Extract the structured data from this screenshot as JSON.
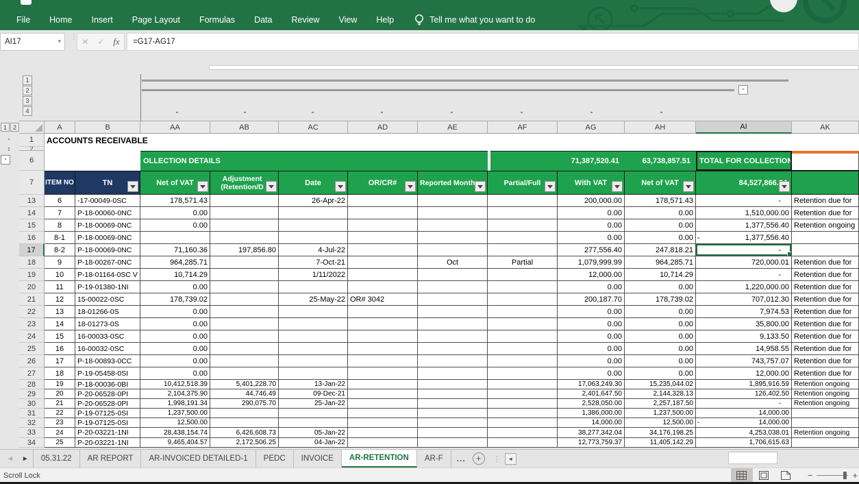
{
  "colors": {
    "ribbon_green": "#217346",
    "header_green": "#1FA24D",
    "header_navy": "#1F3864",
    "selection_green": "#1E7145",
    "orange_accent": "#E8752B"
  },
  "icons": {
    "lightbulb": "bulb",
    "namebox_caret": "▾",
    "cancel": "✕",
    "confirm": "✓",
    "fx": "fx",
    "nav_left": "◄",
    "nav_right": "►",
    "scroll_left": "◄",
    "add_sheet": "+",
    "overflow_dots": "...",
    "zoom_minus": "−",
    "zoom_plus": "+",
    "outline_collapse": "-"
  },
  "ribbon": {
    "tabs": [
      "File",
      "Home",
      "Insert",
      "Page Layout",
      "Formulas",
      "Data",
      "Review",
      "View",
      "Help"
    ],
    "tell_me": "Tell me what you want to do"
  },
  "formula_bar": {
    "name_box": "AI17",
    "formula": "=G17-AG17"
  },
  "outline": {
    "col_levels": [
      "1",
      "2",
      "3",
      "4"
    ],
    "row_levels": [
      "1",
      "2"
    ]
  },
  "sheet": {
    "columns": [
      "A",
      "B",
      "AA",
      "AB",
      "AC",
      "AD",
      "AE",
      "AF",
      "AG",
      "AH",
      "AI",
      "AK"
    ],
    "selected_column": "AI",
    "active_row": 17,
    "row1_title": "ACCOUNTS RECEIVABLE",
    "row1_num": "1",
    "row2_num": "2",
    "row6_num": "6",
    "row7_num": "7",
    "row6": {
      "collection_details": "OLLECTION DETAILS",
      "ag_total": "71,387,520.41",
      "ah_total": "63,738,857.51",
      "ai_label": "TOTAL FOR COLLECTION"
    },
    "row7": {
      "a": "ITEM NO",
      "b": "TN",
      "aa": "Net of VAT",
      "ab_line1": "Adjustment",
      "ab_line2": "(Retention/D",
      "ac": "Date",
      "ad": "OR/CR#",
      "ae": "Reported Month",
      "af": "Partial/Full",
      "ag": "With VAT",
      "ah": "Net of VAT",
      "ai_total": "84,527,866.84"
    },
    "rows": [
      {
        "r": "13",
        "item": "6",
        "tn": "-17-00049-0SC",
        "aa": "178,571.43",
        "ab": "",
        "ac": "26-Apr-22",
        "ad": "",
        "ae": "",
        "af": "",
        "ag": "200,000.00",
        "ah": "178,571.43",
        "ai": "-",
        "ak": "Retention due for"
      },
      {
        "r": "14",
        "item": "7",
        "tn": "P-18-00060-0NC",
        "aa": "0.00",
        "ab": "",
        "ac": "",
        "ad": "",
        "ae": "",
        "af": "",
        "ag": "0.00",
        "ah": "0.00",
        "ai": "1,510,000.00",
        "ak": "Retention due for"
      },
      {
        "r": "15",
        "item": "8",
        "tn": "P-18-00069-0NC",
        "aa": "0.00",
        "ab": "",
        "ac": "",
        "ad": "",
        "ae": "",
        "af": "",
        "ag": "0.00",
        "ah": "0.00",
        "ai": "1,377,556.40",
        "ak": "Retention ongoing"
      },
      {
        "r": "16",
        "item": "8-1",
        "tn": "P-18-00069-0NC",
        "aa": "",
        "ab": "",
        "ac": "",
        "ad": "",
        "ae": "",
        "af": "",
        "ag": "0.00",
        "ah": "0.00",
        "ai": "-1,377,556.40",
        "ak": ""
      },
      {
        "r": "17",
        "item": "8-2",
        "tn": "P-18-00069-0NC",
        "aa": "71,160.36",
        "ab": "197,856.80",
        "ac": "4-Jul-22",
        "ad": "",
        "ae": "",
        "af": "",
        "ag": "277,556.40",
        "ah": "247,818.21",
        "ai": "-",
        "ak": ""
      },
      {
        "r": "18",
        "item": "9",
        "tn": "P-18-00267-0NC",
        "aa": "964,285.71",
        "ab": "",
        "ac": "7-Oct-21",
        "ad": "",
        "ae": "Oct",
        "af": "Partial",
        "ag": "1,079,999.99",
        "ah": "964,285.71",
        "ai": "720,000.01",
        "ak": "Retention due for"
      },
      {
        "r": "19",
        "item": "10",
        "tn": "P-18-01164-0SC V",
        "aa": "10,714.29",
        "ab": "",
        "ac": "1/11/2022",
        "ad": "",
        "ae": "",
        "af": "",
        "ag": "12,000.00",
        "ah": "10,714.29",
        "ai": "-",
        "ak": "Retention due for"
      },
      {
        "r": "20",
        "item": "11",
        "tn": "P-19-01380-1NI",
        "aa": "0.00",
        "ab": "",
        "ac": "",
        "ad": "",
        "ae": "",
        "af": "",
        "ag": "0.00",
        "ah": "0.00",
        "ai": "1,220,000.00",
        "ak": "Retention due for"
      },
      {
        "r": "21",
        "item": "12",
        "tn": "15-00022-0SC",
        "aa": "178,739.02",
        "ab": "",
        "ac": "25-May-22",
        "ad": "OR# 3042",
        "ae": "",
        "af": "",
        "ag": "200,187.70",
        "ah": "178,739.02",
        "ai": "707,012.30",
        "ak": "Retention due for"
      },
      {
        "r": "22",
        "item": "13",
        "tn": "18-01266-0S",
        "aa": "0.00",
        "ab": "",
        "ac": "",
        "ad": "",
        "ae": "",
        "af": "",
        "ag": "0.00",
        "ah": "0.00",
        "ai": "7,974.53",
        "ak": "Retention due for"
      },
      {
        "r": "23",
        "item": "14",
        "tn": "18-01273-0S",
        "aa": "0.00",
        "ab": "",
        "ac": "",
        "ad": "",
        "ae": "",
        "af": "",
        "ag": "0.00",
        "ah": "0.00",
        "ai": "35,800.00",
        "ak": "Retention due for"
      },
      {
        "r": "24",
        "item": "15",
        "tn": "16-00033-0SC",
        "aa": "0.00",
        "ab": "",
        "ac": "",
        "ad": "",
        "ae": "",
        "af": "",
        "ag": "0.00",
        "ah": "0.00",
        "ai": "9,133.50",
        "ak": "Retention due for"
      },
      {
        "r": "25",
        "item": "16",
        "tn": "16-00032-0SC",
        "aa": "0.00",
        "ab": "",
        "ac": "",
        "ad": "",
        "ae": "",
        "af": "",
        "ag": "0.00",
        "ah": "0.00",
        "ai": "14,958.55",
        "ak": "Retention due for"
      },
      {
        "r": "26",
        "item": "17",
        "tn": "P-18-00893-0CC",
        "aa": "0.00",
        "ab": "",
        "ac": "",
        "ad": "",
        "ae": "",
        "af": "",
        "ag": "0.00",
        "ah": "0.00",
        "ai": "743,757.07",
        "ak": "Retention due for"
      },
      {
        "r": "27",
        "item": "18",
        "tn": "P-19-05458-0SI",
        "aa": "0.00",
        "ab": "",
        "ac": "",
        "ad": "",
        "ae": "",
        "af": "",
        "ag": "0.00",
        "ah": "0.00",
        "ai": "12,000.00",
        "ak": "Retention due for"
      },
      {
        "r": "28",
        "item": "19",
        "tn": "P-18-00036-0BI",
        "aa": "10,412,518.39",
        "ab": "5,401,228.70",
        "ac": "13-Jan-22",
        "ad": "",
        "ae": "",
        "af": "",
        "ag": "17,063,249.30",
        "ah": "15,235,044.02",
        "ai": "1,895,916.59",
        "ak": "Retention ongoing"
      },
      {
        "r": "29",
        "item": "20",
        "tn": "P-20-06528-0PI",
        "aa": "2,104,375.90",
        "ab": "44,746.49",
        "ac": "09-Dec-21",
        "ad": "",
        "ae": "",
        "af": "",
        "ag": "2,401,647.50",
        "ah": "2,144,328.13",
        "ai": "126,402.50",
        "ak": "Retention ongoing"
      },
      {
        "r": "30",
        "item": "21",
        "tn": "P-20-06528-0PI",
        "aa": "1,998,191.34",
        "ab": "290,075.70",
        "ac": "25-Jan-22",
        "ad": "",
        "ae": "",
        "af": "",
        "ag": "2,528,050.00",
        "ah": "2,257,187.50",
        "ai": "-",
        "ak": "Retention ongoing"
      },
      {
        "r": "31",
        "item": "22",
        "tn": "P-19-07125-0SI",
        "aa": "1,237,500.00",
        "ab": "",
        "ac": "",
        "ad": "",
        "ae": "",
        "af": "",
        "ag": "1,386,000.00",
        "ah": "1,237,500.00",
        "ai": "14,000.00",
        "ak": ""
      },
      {
        "r": "32",
        "item": "23",
        "tn": "P-19-07125-0SI",
        "aa": "12,500.00",
        "ab": "",
        "ac": "",
        "ad": "",
        "ae": "",
        "af": "",
        "ag": "14,000.00",
        "ah": "12,500.00",
        "ai": "-14,000.00",
        "ak": ""
      },
      {
        "r": "33",
        "item": "24",
        "tn": "P-20-03221-1NI",
        "aa": "28,438,154.74",
        "ab": "6,426,608.73",
        "ac": "05-Jan-22",
        "ad": "",
        "ae": "",
        "af": "",
        "ag": "38,277,342.04",
        "ah": "34,176,198.25",
        "ai": "4,253,038.01",
        "ak": "Retention ongoing"
      },
      {
        "r": "34",
        "item": "25",
        "tn": "P-20-03221-1NI",
        "aa": "9,465,404.57",
        "ab": "2,172,506.25",
        "ac": "04-Jan-22",
        "ad": "",
        "ae": "",
        "af": "",
        "ag": "12,773,759.37",
        "ah": "11,405,142.29",
        "ai": "1,706,615.63",
        "ak": ""
      }
    ]
  },
  "tabs": {
    "items": [
      "05.31.22",
      "AR REPORT",
      "AR-INVOICED DETAILED-1",
      "PEDC",
      "INVOICE",
      "AR-RETENTION",
      "AR-F"
    ],
    "active": "AR-RETENTION"
  },
  "status": {
    "left": "Scroll Lock"
  }
}
